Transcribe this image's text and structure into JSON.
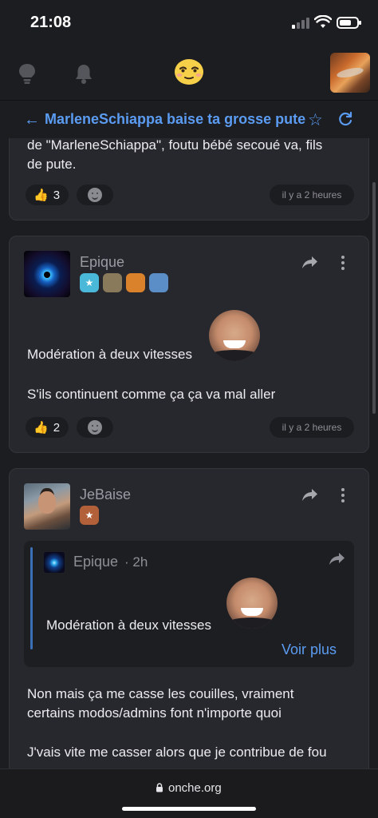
{
  "status_bar": {
    "time": "21:08"
  },
  "header": {
    "icons": [
      "lightbulb-icon",
      "bell-icon",
      "onche-logo",
      "user-avatar"
    ]
  },
  "topic": {
    "title": "MarleneSchiappa baise ta grosse pute"
  },
  "posts": [
    {
      "text_line1": "de \"MarleneSchiappa\", foutu bébé secoué va, fils",
      "text_line2": "de pute.",
      "likes": "3",
      "time": "il y a 2 heures"
    },
    {
      "username": "Epique",
      "badges": [
        "star-badge",
        "avatar-badge",
        "chicken-badge",
        "face-badge"
      ],
      "line1": "Modération à deux vitesses",
      "line2": "S'ils continuent comme ça ça va mal aller",
      "likes": "2",
      "time": "il y a 2 heures"
    },
    {
      "username": "JeBaise",
      "quote": {
        "username": "Epique",
        "time": "· 2h",
        "text": "Modération à deux vitesses",
        "more": "Voir plus"
      },
      "line1": "Non mais ça me casse les couilles, vraiment",
      "line2": "certains modos/admins font n'importe quoi",
      "line3": "J'vais vite me casser alors que je contribue de fou"
    }
  ],
  "url_bar": {
    "url": "onche.org"
  },
  "colors": {
    "accent": "#5b9cf2",
    "background": "#1c1d21",
    "card": "#27282d"
  }
}
